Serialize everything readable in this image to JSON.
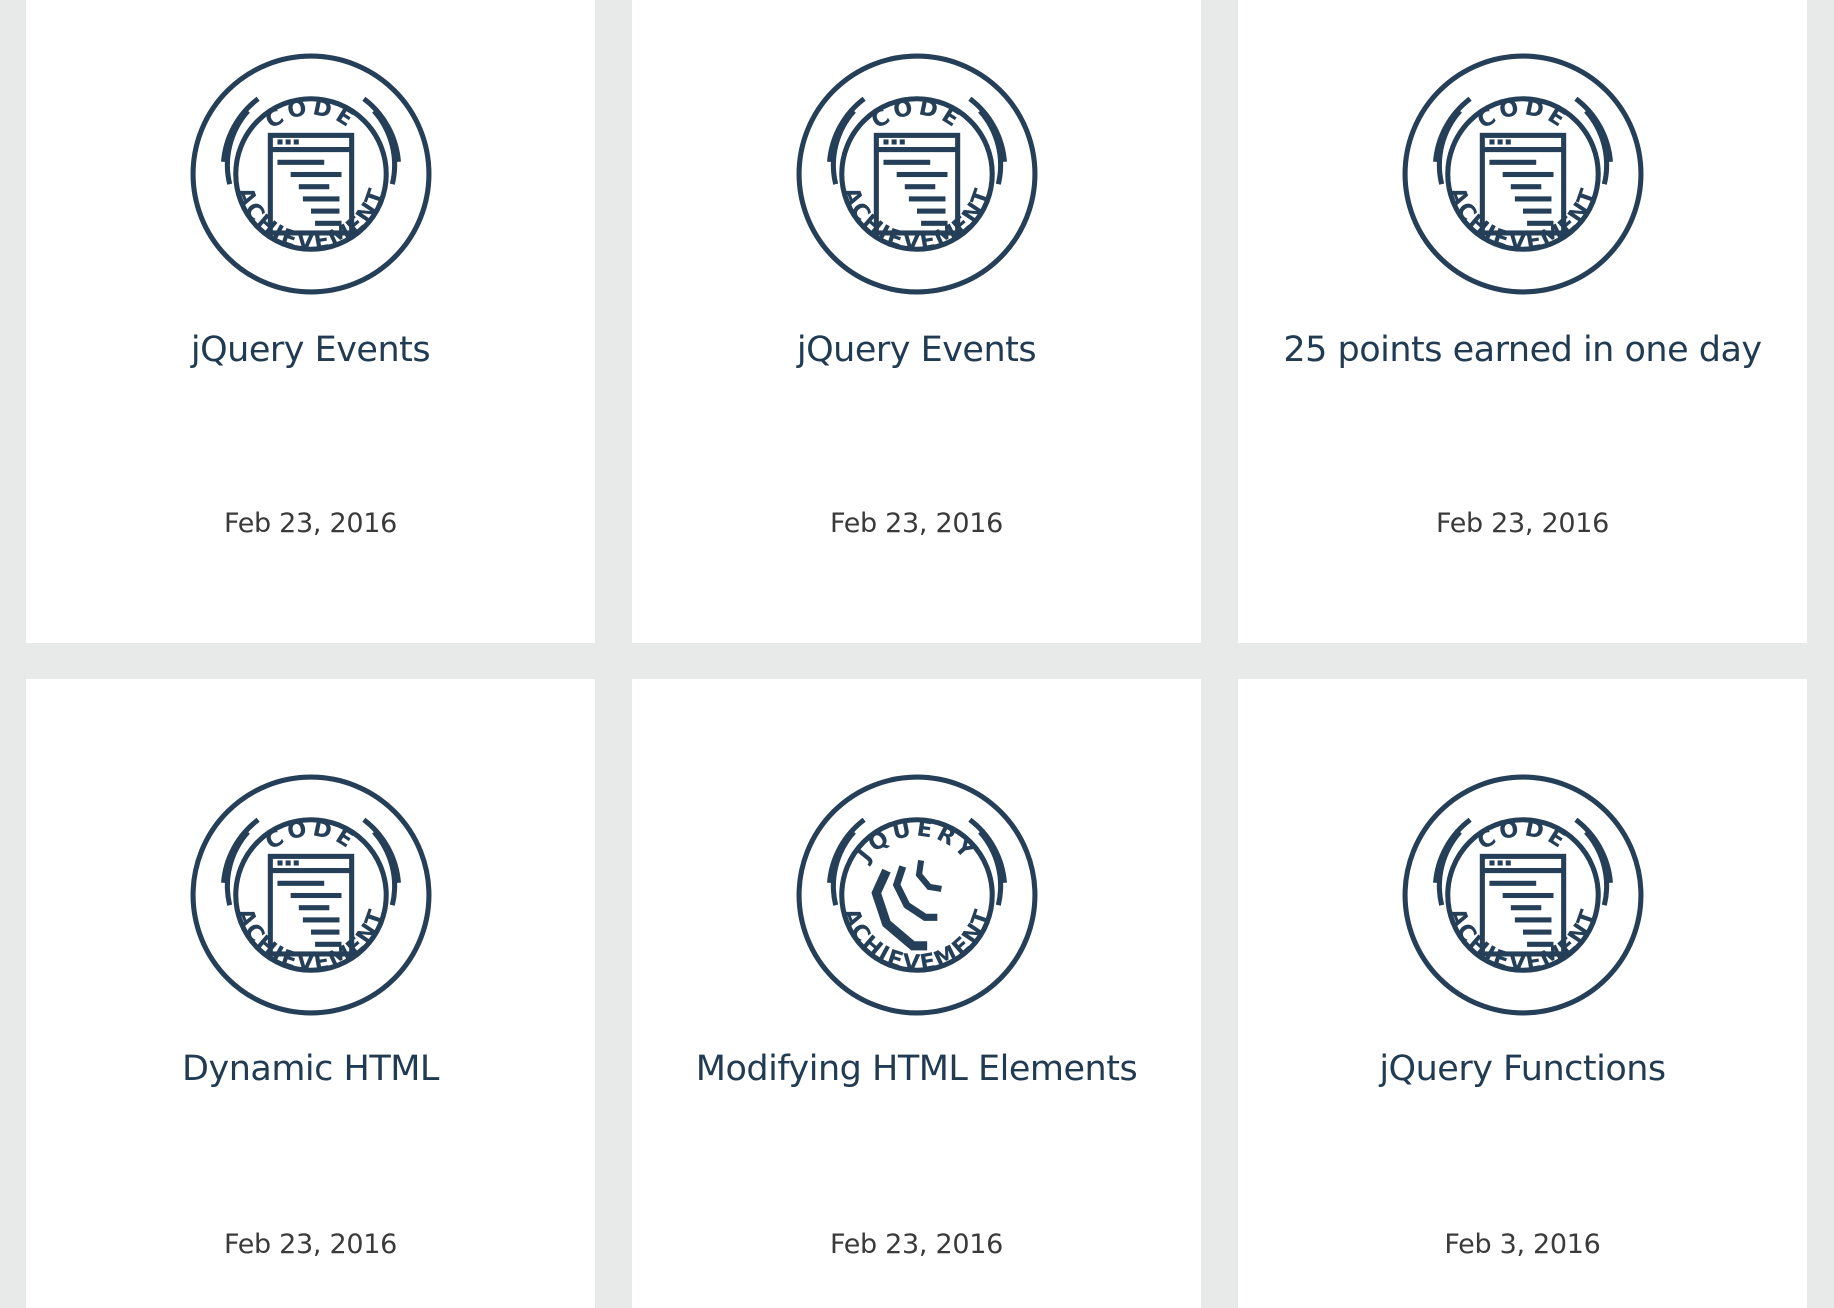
{
  "achievements": [
    {
      "badge_type": "code",
      "badge_top_text": "CODE",
      "badge_bottom_text": "ACHIEVEMENT",
      "title": "jQuery Events",
      "date": "Feb 23, 2016"
    },
    {
      "badge_type": "code",
      "badge_top_text": "CODE",
      "badge_bottom_text": "ACHIEVEMENT",
      "title": "jQuery Events",
      "date": "Feb 23, 2016"
    },
    {
      "badge_type": "code",
      "badge_top_text": "CODE",
      "badge_bottom_text": "ACHIEVEMENT",
      "title": "25 points earned in one day",
      "date": "Feb 23, 2016"
    },
    {
      "badge_type": "code",
      "badge_top_text": "CODE",
      "badge_bottom_text": "ACHIEVEMENT",
      "title": "Dynamic HTML",
      "date": "Feb 23, 2016"
    },
    {
      "badge_type": "jquery",
      "badge_top_text": "JQUERY",
      "badge_bottom_text": "ACHIEVEMENT",
      "title": "Modifying HTML Elements",
      "date": "Feb 23, 2016"
    },
    {
      "badge_type": "code",
      "badge_top_text": "CODE",
      "badge_bottom_text": "ACHIEVEMENT",
      "title": "jQuery Functions",
      "date": "Feb 3, 2016"
    }
  ],
  "colors": {
    "badge_ink": "#243f57",
    "title_text": "#213b53",
    "date_text": "#3a3a3a",
    "card_bg": "#ffffff",
    "page_bg": "#e8eaea"
  }
}
